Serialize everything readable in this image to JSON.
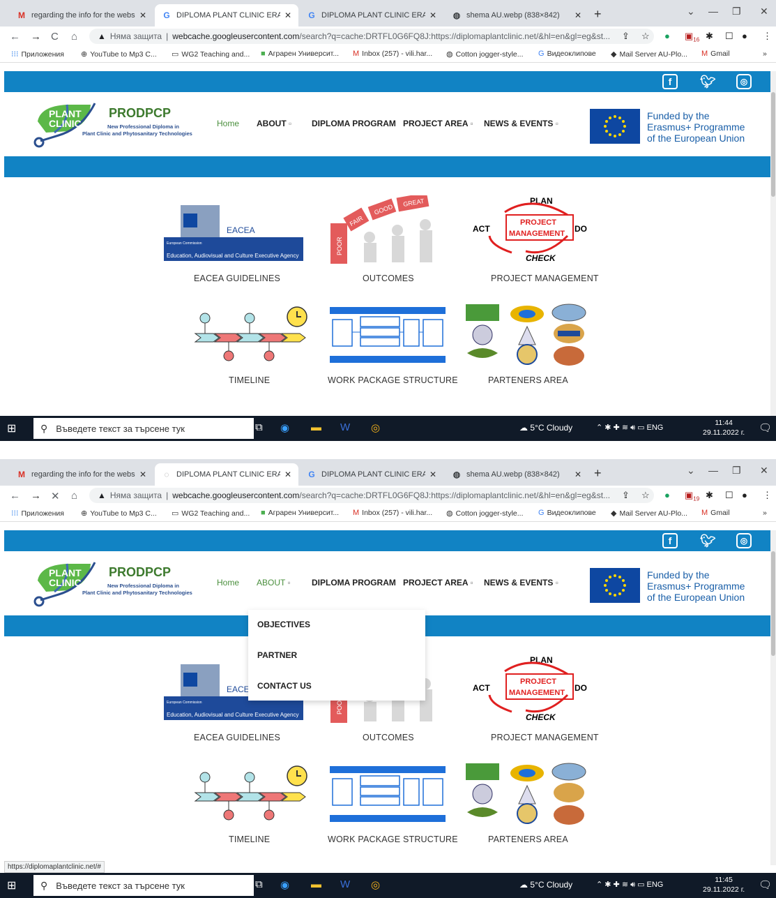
{
  "tabs": [
    {
      "label": "regarding the info for the websit"
    },
    {
      "label": "DIPLOMA PLANT CLINIC ERASMU"
    },
    {
      "label": "DIPLOMA PLANT CLINIC ERASMU"
    },
    {
      "label": "shema AU.webp (838×842)"
    }
  ],
  "address": {
    "security": "Няма защита",
    "domain": "webcache.googleusercontent.com",
    "path": "/search?q=cache:DRTFL0G6FQ8J:https://diplomaplantclinic.net/&hl=en&gl=eg&st..."
  },
  "bookmarks": [
    "Приложения",
    "YouTube to Mp3 C...",
    "WG2 Teaching and...",
    "Аграрен Университ...",
    "Inbox (257) - vili.har...",
    "Cotton jogger-style...",
    "Видеоклипове",
    "Mail Server AU-Plo...",
    "Gmail"
  ],
  "ext_badges": {
    "top": "16",
    "bottom": "19"
  },
  "logo": {
    "plant": "PLANT",
    "clinic": "CLINIC",
    "title": "PRODPCP",
    "sub1": "New Professional Diploma in",
    "sub2": "Plant Clinic and Phytosanitary Technologies"
  },
  "menu": {
    "home": "Home",
    "about": "ABOUT",
    "diploma": "DIPLOMA PROGRAM",
    "project_area": "PROJECT AREA",
    "news": "NEWS & EVENTS",
    "caret": "▫"
  },
  "eu": {
    "line1": "Funded by the",
    "line2": "Erasmus+ Programme",
    "line3": "of the European Union"
  },
  "cards": {
    "eacea": "EACEA GUIDELINES",
    "eacea_name": "EACEA",
    "eacea_sub": "Education, Audiovisual and Culture Executive Agency",
    "eacea_ec": "European Commission",
    "outcomes": "OUTCOMES",
    "o1": "POOR",
    "o2": "FAIR",
    "o3": "GOOD",
    "o4": "GREAT",
    "pm": "PROJECT MANAGEMENT",
    "plan": "PLAN",
    "act": "ACT",
    "do": "DO",
    "check": "CHECK",
    "pm1": "PROJECT",
    "pm2": "MANAGEMENT",
    "timeline": "TIMELINE",
    "wps": "WORK PACKAGE STRUCTURE",
    "partners": "PARTENERS AREA"
  },
  "dropdown": [
    "OBJECTIVES",
    "PARTNER",
    "CONTACT US"
  ],
  "taskbar": {
    "search": "Въведете текст за търсене тук",
    "weather": "5°C  Cloudy",
    "lang": "ENG",
    "time1": "11:44",
    "time2": "11:45",
    "date": "29.11.2022 г."
  },
  "status_url": "https://diplomaplantclinic.net/#"
}
